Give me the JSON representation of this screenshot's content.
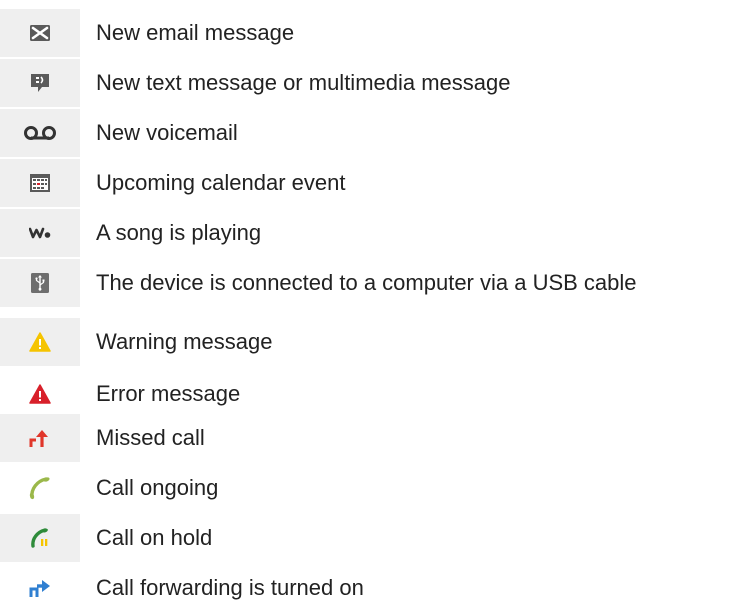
{
  "items": [
    {
      "icon": "email-icon",
      "label": "New email message"
    },
    {
      "icon": "text-message-icon",
      "label": "New text message or multimedia message"
    },
    {
      "icon": "voicemail-icon",
      "label": "New voicemail"
    },
    {
      "icon": "calendar-icon",
      "label": "Upcoming calendar event"
    },
    {
      "icon": "walkman-icon",
      "label": "A song is playing"
    },
    {
      "icon": "usb-icon",
      "label": "The device is connected to a computer via a USB cable"
    },
    {
      "icon": "warning-icon",
      "label": "Warning message"
    },
    {
      "icon": "error-icon",
      "label": "Error message"
    },
    {
      "icon": "missed-call-icon",
      "label": "Missed call"
    },
    {
      "icon": "call-ongoing-icon",
      "label": "Call ongoing"
    },
    {
      "icon": "call-on-hold-icon",
      "label": "Call on hold"
    },
    {
      "icon": "call-forwarding-icon",
      "label": "Call forwarding is turned on"
    }
  ],
  "colors": {
    "icon_background": "#efefef",
    "text": "#222222",
    "icon_gray": "#5a5a5a",
    "warning": "#f5c400",
    "error": "#d8202a",
    "missed": "#e0362a",
    "call_green": "#9bb84a",
    "hold_green": "#2e8b3a",
    "forward_blue": "#2f7fd1"
  }
}
